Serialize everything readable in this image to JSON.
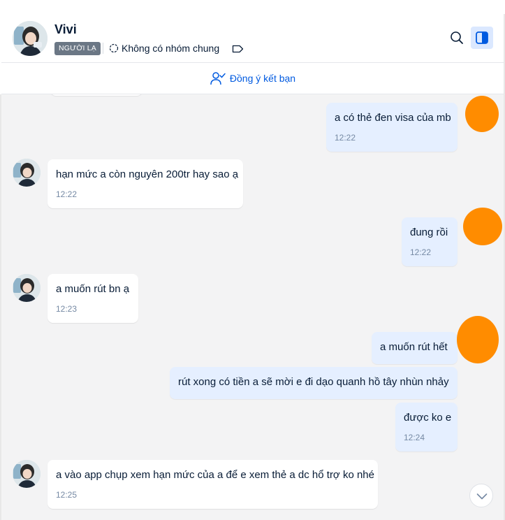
{
  "contact": {
    "name": "Vivi",
    "badge": "NGƯỜI LẠ",
    "group_status": "Không có nhóm chung"
  },
  "icons": {
    "group": "group-circle-icon",
    "tag": "tag-icon",
    "search": "search-icon",
    "panel": "sidebar-toggle-icon",
    "add_friend": "user-check-icon",
    "scroll": "chevron-down-icon"
  },
  "friend_request": {
    "label": "Đồng ý kết bạn"
  },
  "messages": [
    {
      "dir": "out",
      "text": "a có thẻ đen visa của mb",
      "time": "12:22"
    },
    {
      "dir": "in",
      "text": "hạn mức a còn nguyên 200tr hay sao ạ",
      "time": "12:22"
    },
    {
      "dir": "out",
      "text": "đung rồi",
      "time": "12:22"
    },
    {
      "dir": "in",
      "text": "a muốn rút bn ạ",
      "time": "12:23"
    },
    {
      "dir": "out",
      "text": "a muốn rút hết",
      "time": ""
    },
    {
      "dir": "out",
      "text": "rút xong có tiền a sẽ mời e đi dạo quanh hồ tây nhùn nhảy",
      "time": ""
    },
    {
      "dir": "out",
      "text": "được ko e",
      "time": "12:24"
    },
    {
      "dir": "in",
      "text": "a vào app chụp xem hạn mức của a để e xem thẻ a dc hổ trợ ko nhé",
      "time": "12:25"
    }
  ],
  "colors": {
    "accent": "#005ae0",
    "outgoing_bubble": "#e5efff",
    "incoming_bubble": "#ffffff",
    "chat_bg": "#f3f3f4",
    "redaction": "#ff8c00",
    "badge_bg": "#6b7785"
  }
}
